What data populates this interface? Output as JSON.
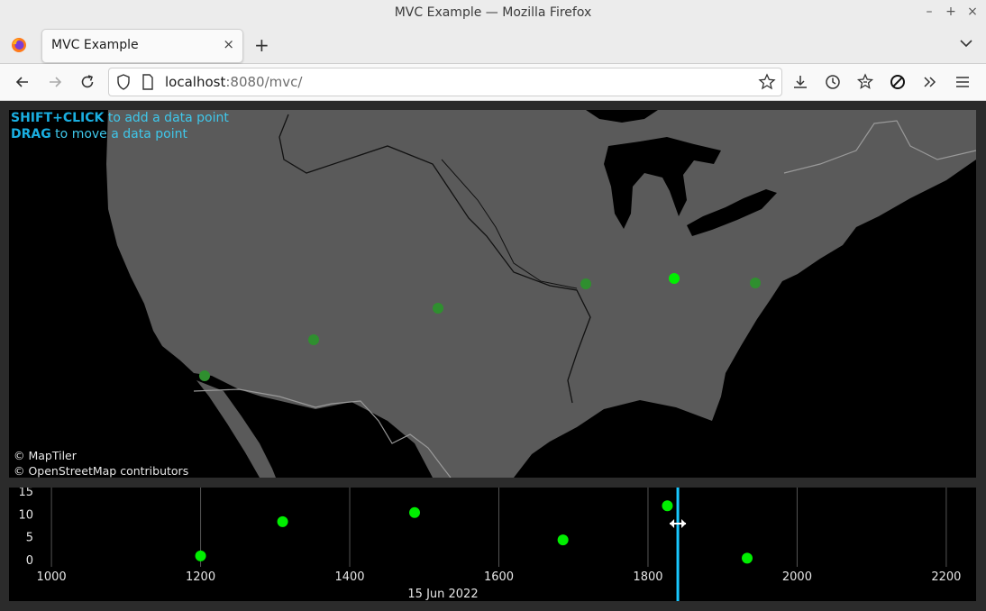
{
  "window": {
    "title": "MVC Example — Mozilla Firefox",
    "controls": [
      "–",
      "+",
      "×"
    ]
  },
  "tab": {
    "title": "MVC Example",
    "close": "×"
  },
  "toolbar": {
    "new_tab": "+"
  },
  "urlbar": {
    "host": "localhost",
    "path": ":8080/mvc/"
  },
  "map": {
    "hint1_key": "SHIFT+CLICK",
    "hint1_text": " to add a data point",
    "hint2_key": "DRAG",
    "hint2_text": " to move a data point",
    "attribution1": "© MapTiler",
    "attribution2": "© OpenStreetMap contributors"
  },
  "colors": {
    "point_active": "#00ee00",
    "point_dim": "#2f8f2f",
    "cursor": "#19c8ff",
    "land": "#5a5a5a",
    "water": "#000000"
  },
  "timeline": {
    "date_label": "15 Jun 2022",
    "cursor_x": 1840,
    "cursor_icon": "resize-horizontal-icon"
  },
  "chart_data": {
    "type": "scatter",
    "x_ticks": [
      "1000",
      "1200",
      "1400",
      "1600",
      "1800",
      "2000",
      "2200"
    ],
    "y_ticks": [
      "0",
      "5",
      "10",
      "15"
    ],
    "xlim": [
      960,
      2240
    ],
    "ylim": [
      -2,
      16
    ],
    "points": [
      {
        "x": 1200,
        "y": 1
      },
      {
        "x": 1310,
        "y": 8.5
      },
      {
        "x": 1487,
        "y": 10.5
      },
      {
        "x": 1686,
        "y": 4.5
      },
      {
        "x": 1826,
        "y": 12
      },
      {
        "x": 1933,
        "y": 0.5
      }
    ]
  }
}
